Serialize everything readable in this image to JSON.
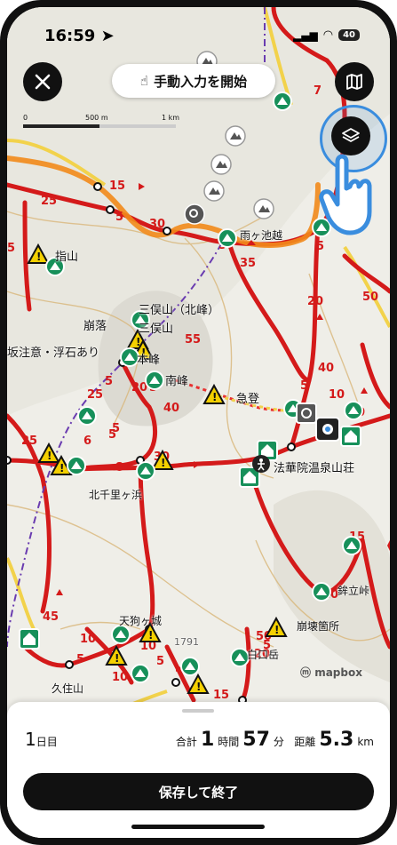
{
  "status_bar": {
    "time": "16:59",
    "battery": "40"
  },
  "header": {
    "manual_input_label": "手動入力を開始"
  },
  "scale": {
    "zero": "0",
    "mid": "500 m",
    "end": "1 km"
  },
  "map_labels": {
    "sashiyama": "指山",
    "hokuho": "三俣山（北峰）",
    "mimata": "三俣山",
    "honpo": "本峰",
    "nanpo": "南峰",
    "kuzure": "崩落",
    "saka": "坂注意・浮石あり",
    "kyuto": "急登",
    "amagaike": "雨ヶ池越",
    "kitasenri": "北千里ヶ浜",
    "tengu": "天狗ヶ城",
    "hokkaiin": "法華院温泉山荘",
    "kuzurekasho": "崩壊箇所",
    "shirakuchi": "白口岳",
    "kuju": "久住山",
    "tateyama": "鉾立峠",
    "elev": "1791",
    "mapbox": "mapbox"
  },
  "bottom_sheet": {
    "day_number": "1",
    "day_unit": "日目",
    "total_label": "合計",
    "hours": "1",
    "hours_unit": "時間",
    "minutes": "57",
    "minutes_unit": "分",
    "distance_label": "距離",
    "distance": "5.3",
    "distance_unit": "km",
    "save_button": "保存して終了"
  }
}
